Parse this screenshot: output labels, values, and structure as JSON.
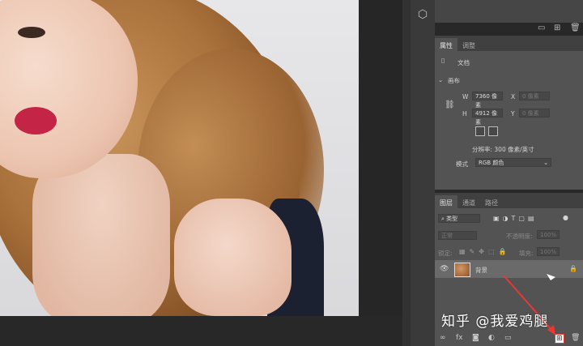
{
  "panel_top_icons": [
    "folder-icon",
    "new-doc-icon",
    "trash-icon"
  ],
  "properties": {
    "tabs": [
      "属性",
      "调整"
    ],
    "doc_label": "文档",
    "canvas_label": "画布",
    "w_label": "W",
    "w_value": "7360 像素",
    "h_label": "H",
    "h_value": "4912 像素",
    "x_label": "X",
    "x_placeholder": "0 像素",
    "y_label": "Y",
    "y_placeholder": "0 像素",
    "resolution": "分辨率: 300 像素/英寸",
    "mode_label": "模式",
    "mode_value": "RGB 颜色"
  },
  "layers": {
    "tabs": [
      "图层",
      "通道",
      "路径"
    ],
    "kind_filter": "类型",
    "blend_mode": "正常",
    "opacity_label": "不透明度:",
    "opacity_value": "100%",
    "lock_label": "锁定:",
    "fill_label": "填充:",
    "fill_value": "100%",
    "layer_name": "背景"
  },
  "watermark": "知乎 @我爱鸡腿",
  "accent_arrow_color": "#e53935"
}
